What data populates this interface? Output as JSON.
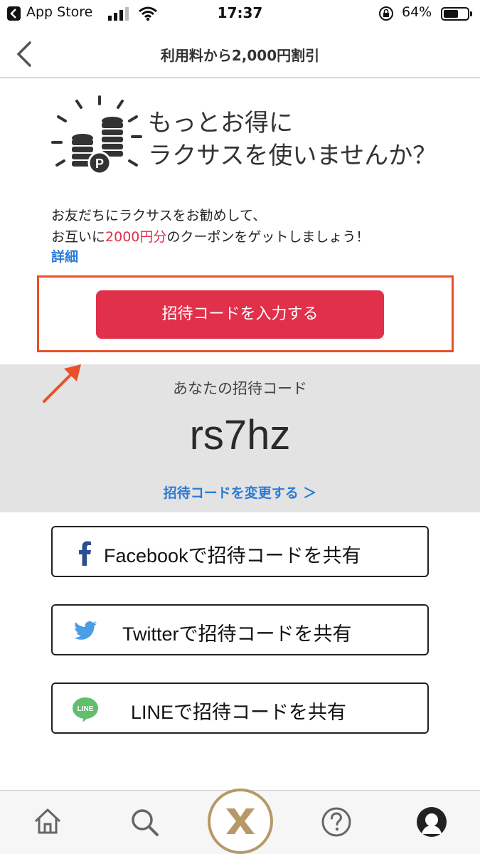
{
  "status_bar": {
    "back_app": "App Store",
    "time": "17:37",
    "battery_percent": "64%",
    "battery_level": 0.64
  },
  "nav": {
    "title": "利用料から2,000円割引"
  },
  "hero": {
    "title": "もっとお得に\nラクサスを使いませんか？"
  },
  "description": {
    "line1": "お友だちにラクサスをお勧めして、",
    "line2_prefix": "お互いに",
    "line2_highlight": "2000円分",
    "line2_suffix": "のクーポンをゲットしましょう！",
    "details_link": "詳細"
  },
  "invite_button": {
    "label": "招待コードを入力する"
  },
  "code_section": {
    "label": "あなたの招待コード",
    "code": "rs7hz",
    "change_link": "招待コードを変更する ＞"
  },
  "share": [
    {
      "label": "Facebookで招待コードを共有",
      "icon": "facebook-icon"
    },
    {
      "label": "Twitterで招待コードを共有",
      "icon": "twitter-icon"
    },
    {
      "label": "LINEで招待コードを共有",
      "icon": "line-icon"
    }
  ],
  "tab_bar": {
    "tabs": [
      "home-icon",
      "search-icon",
      "laxus-logo",
      "help-icon",
      "profile-icon"
    ]
  },
  "colors": {
    "accent_red": "#e0304a",
    "link_blue": "#2a7bd6",
    "annotation_orange": "#e8502a",
    "gold": "#b89868"
  }
}
